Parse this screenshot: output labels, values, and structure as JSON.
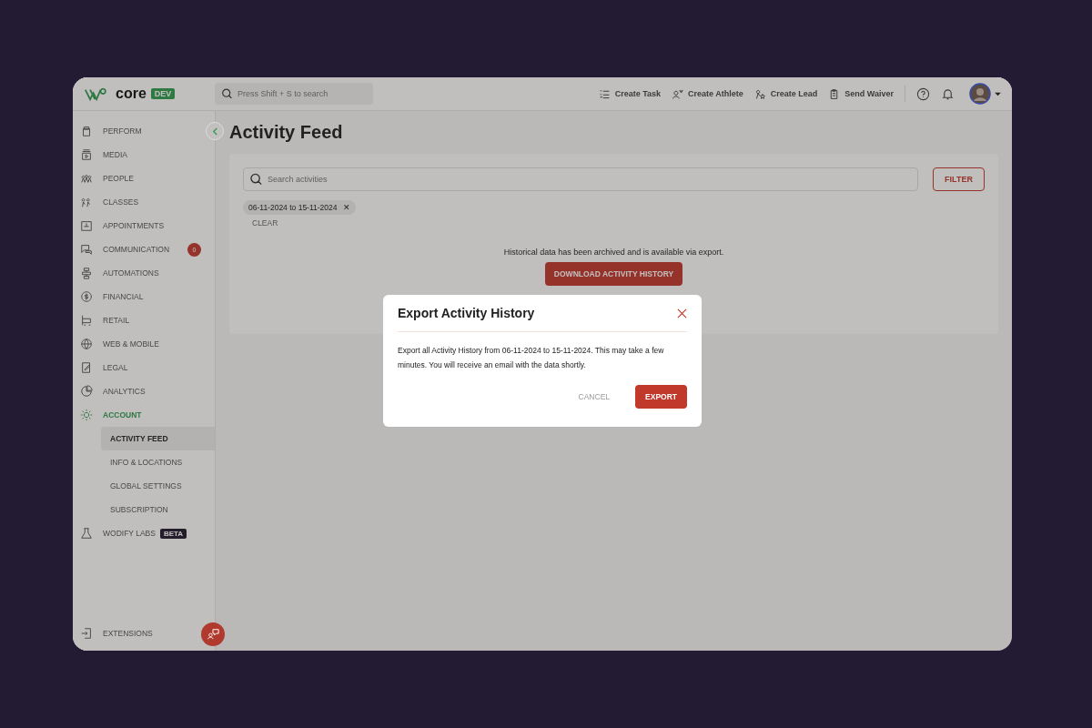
{
  "brand": {
    "name": "core",
    "env_tag": "DEV"
  },
  "search": {
    "placeholder": "Press Shift + S to search"
  },
  "top_actions": [
    {
      "label": "Create Task"
    },
    {
      "label": "Create Athlete"
    },
    {
      "label": "Create Lead"
    },
    {
      "label": "Send Waiver"
    }
  ],
  "sidebar": {
    "items": [
      {
        "label": "PERFORM",
        "selected": false
      },
      {
        "label": "MEDIA",
        "selected": false
      },
      {
        "label": "PEOPLE",
        "selected": false
      },
      {
        "label": "CLASSES",
        "selected": false
      },
      {
        "label": "APPOINTMENTS",
        "selected": false
      },
      {
        "label": "COMMUNICATION",
        "selected": false,
        "badge": "0"
      },
      {
        "label": "AUTOMATIONS",
        "selected": false
      },
      {
        "label": "FINANCIAL",
        "selected": false
      },
      {
        "label": "RETAIL",
        "selected": false
      },
      {
        "label": "WEB & MOBILE",
        "selected": false
      },
      {
        "label": "LEGAL",
        "selected": false
      },
      {
        "label": "ANALYTICS",
        "selected": false
      },
      {
        "label": "ACCOUNT",
        "selected": true,
        "children": [
          {
            "label": "ACTIVITY FEED",
            "selected": true
          },
          {
            "label": "INFO & LOCATIONS",
            "selected": false
          },
          {
            "label": "GLOBAL SETTINGS",
            "selected": false
          },
          {
            "label": "SUBSCRIPTION",
            "selected": false
          }
        ]
      },
      {
        "label": "WODIFY LABS",
        "selected": false,
        "tag": "BETA"
      }
    ],
    "footer": {
      "label": "EXTENSIONS"
    }
  },
  "page": {
    "title": "Activity Feed",
    "search": {
      "placeholder": "Search activities"
    },
    "filter_button": "FILTER",
    "chips": [
      {
        "label": "06-11-2024 to 15-11-2024",
        "remove": "✕"
      }
    ],
    "clear": "CLEAR",
    "message": "Historical data has been archived and is available via export.",
    "download_button": "DOWNLOAD ACTIVITY HISTORY"
  },
  "dialog": {
    "title": "Export Activity History",
    "body": "Export all Activity History from 06-11-2024 to 15-11-2024. This may take a few minutes. You will receive an email with the data shortly.",
    "buttons": [
      {
        "label": "CANCEL",
        "kind": "text"
      },
      {
        "label": "EXPORT",
        "kind": "primary"
      }
    ]
  }
}
